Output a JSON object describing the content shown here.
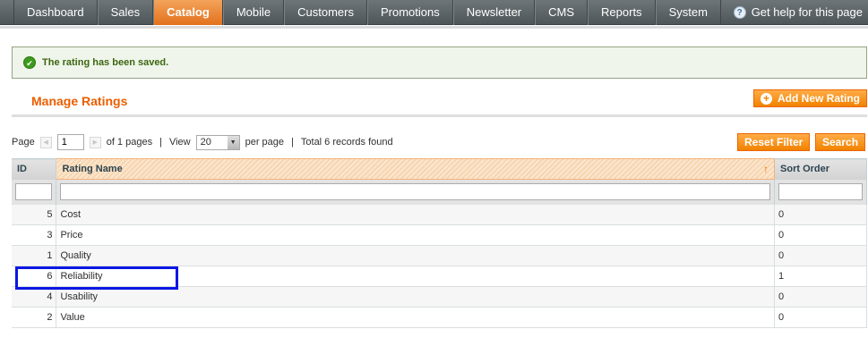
{
  "nav": {
    "items": [
      {
        "label": "Dashboard"
      },
      {
        "label": "Sales"
      },
      {
        "label": "Catalog",
        "active": true
      },
      {
        "label": "Mobile"
      },
      {
        "label": "Customers"
      },
      {
        "label": "Promotions"
      },
      {
        "label": "Newsletter"
      },
      {
        "label": "CMS"
      },
      {
        "label": "Reports"
      },
      {
        "label": "System"
      }
    ],
    "help_label": "Get help for this page",
    "help_icon": "help-circle-icon"
  },
  "message": {
    "text": "The rating has been saved.",
    "icon": "success-check-icon"
  },
  "page": {
    "title": "Manage Ratings",
    "add_button": "Add New Rating"
  },
  "pager": {
    "page_label": "Page",
    "page_value": "1",
    "of_pages": "of 1 pages",
    "view_label": "View",
    "per_page_value": "20",
    "per_page_label": "per page",
    "total": "Total 6 records found",
    "reset_label": "Reset Filter",
    "search_label": "Search"
  },
  "grid": {
    "columns": [
      "ID",
      "Rating Name",
      "Sort Order"
    ],
    "rows": [
      {
        "id": "5",
        "name": "Cost",
        "sort": "0"
      },
      {
        "id": "3",
        "name": "Price",
        "sort": "0"
      },
      {
        "id": "1",
        "name": "Quality",
        "sort": "0"
      },
      {
        "id": "6",
        "name": "Reliability",
        "sort": "1"
      },
      {
        "id": "4",
        "name": "Usability",
        "sort": "0"
      },
      {
        "id": "2",
        "name": "Value",
        "sort": "0"
      }
    ]
  },
  "colors": {
    "accent": "#eb5e00",
    "button": "#f18200",
    "highlight_box": "#0b17e3",
    "success_text": "#3d6611"
  }
}
